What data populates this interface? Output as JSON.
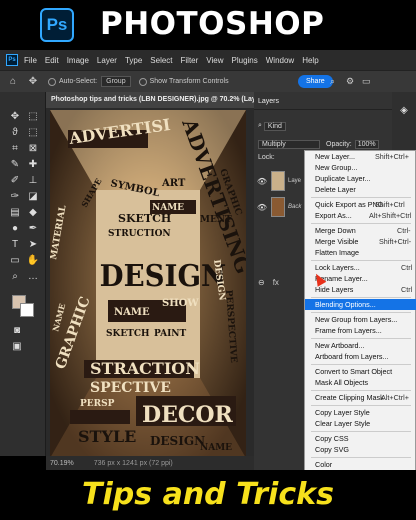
{
  "banner": {
    "logo": "Ps",
    "title": "PHOTOSHOP"
  },
  "menubar": {
    "items": [
      "File",
      "Edit",
      "Image",
      "Layer",
      "Type",
      "Select",
      "Filter",
      "View",
      "Plugins",
      "Window",
      "Help"
    ]
  },
  "options": {
    "auto_select": "Auto-Select:",
    "group": "Group",
    "transform": "Show Transform Controls",
    "share": "Share"
  },
  "document": {
    "tab_title": "Photoshop tips and tricks (LBN DESIGNER).jpg @ 70.2% (Layer 1, R",
    "zoom": "70.19%",
    "info": "736 px x 1241 px (72 ppi)"
  },
  "artwork": {
    "words": [
      "ADVERTISI",
      "ADVERTISING",
      "SYMBOL",
      "ART",
      "NAME",
      "SKETCH",
      "STRUCTION",
      "DESIGN",
      "SHOW",
      "NAME",
      "GRAPHIC",
      "STRACTION",
      "SPECTIVE",
      "DECOR",
      "STYLE",
      "DESIGN",
      "NAME",
      "MATERIAL",
      "DESIGN",
      "SHAPE",
      "PERSPECTIVE",
      "SKETCH",
      "PAINT",
      "MENT",
      "PERSP",
      "GRAPHIC",
      "NAME"
    ]
  },
  "layers_panel": {
    "title": "Layers",
    "kind": "Kind",
    "blend_mode": "Multiply",
    "opacity_label": "Opacity:",
    "opacity": "100%",
    "lock_label": "Lock:",
    "layers": [
      {
        "name": "Laye"
      },
      {
        "name": "Back"
      }
    ],
    "footer_icons": [
      "link-icon",
      "fx-icon"
    ],
    "footer_fx": "fx"
  },
  "context_menu": {
    "items": [
      {
        "label": "New Layer...",
        "shortcut": "Shift+Ctrl+"
      },
      {
        "label": "New Group...",
        "shortcut": ""
      },
      {
        "label": "Duplicate Layer...",
        "shortcut": ""
      },
      {
        "label": "Delete Layer",
        "shortcut": ""
      },
      {
        "label": "Quick Export as PNG",
        "shortcut": "Shift+Ctrl"
      },
      {
        "label": "Export As...",
        "shortcut": "Alt+Shift+Ctrl"
      },
      {
        "label": "Merge Down",
        "shortcut": "Ctrl-"
      },
      {
        "label": "Merge Visible",
        "shortcut": "Shift+Ctrl-"
      },
      {
        "label": "Flatten Image",
        "shortcut": ""
      },
      {
        "label": "Lock Layers...",
        "shortcut": "Ctrl"
      },
      {
        "label": "Rename Layer...",
        "shortcut": ""
      },
      {
        "label": "Hide Layers",
        "shortcut": "Ctrl"
      },
      {
        "label": "Blending Options...",
        "shortcut": ""
      },
      {
        "label": "New Group from Layers...",
        "shortcut": ""
      },
      {
        "label": "Frame from Layers...",
        "shortcut": ""
      },
      {
        "label": "New Artboard...",
        "shortcut": ""
      },
      {
        "label": "Artboard from Layers...",
        "shortcut": ""
      },
      {
        "label": "Convert to Smart Object",
        "shortcut": ""
      },
      {
        "label": "Mask All Objects",
        "shortcut": ""
      },
      {
        "label": "Create Clipping Mask",
        "shortcut": "Alt+Ctrl+"
      },
      {
        "label": "Copy Layer Style",
        "shortcut": ""
      },
      {
        "label": "Clear Layer Style",
        "shortcut": ""
      },
      {
        "label": "Copy CSS",
        "shortcut": ""
      },
      {
        "label": "Copy SVG",
        "shortcut": ""
      },
      {
        "label": "Color",
        "shortcut": ""
      }
    ],
    "highlighted_index": 12
  },
  "caption": {
    "text": "Tips and Tricks"
  },
  "colors": {
    "accent": "#1473e6",
    "caption": "#f7e11c",
    "ps_blue": "#31a8ff",
    "foreground_swatch": "#d8c4b0",
    "background_swatch": "#ffffff"
  }
}
